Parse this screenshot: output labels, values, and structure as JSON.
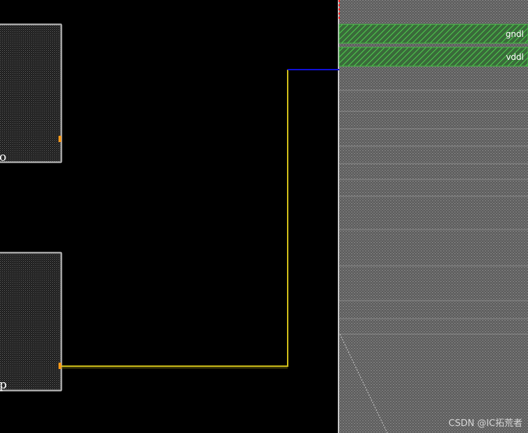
{
  "layout_view": {
    "background": "#000000",
    "colors": {
      "cell_border": "#a8a8a8",
      "cell_fill": "#3a3a3a",
      "region_fill": "#6e6e6e",
      "power_rail": "#2ea82e",
      "signal_wire": "#d4c21a",
      "metal_wire": "#1010d8",
      "pin_marker": "#ff9a1a",
      "marker_red": "#ff2020"
    },
    "cells": [
      {
        "id": "cell-upper",
        "label": "o"
      },
      {
        "id": "cell-lower",
        "label": "p"
      }
    ],
    "power_rails": [
      {
        "net": "gndl"
      },
      {
        "net": "vddl"
      }
    ],
    "wires": [
      {
        "id": "signal-route",
        "color_key": "signal_wire"
      },
      {
        "id": "metal-stub",
        "color_key": "metal_wire"
      }
    ]
  },
  "watermark": "CSDN @IC拓荒者"
}
